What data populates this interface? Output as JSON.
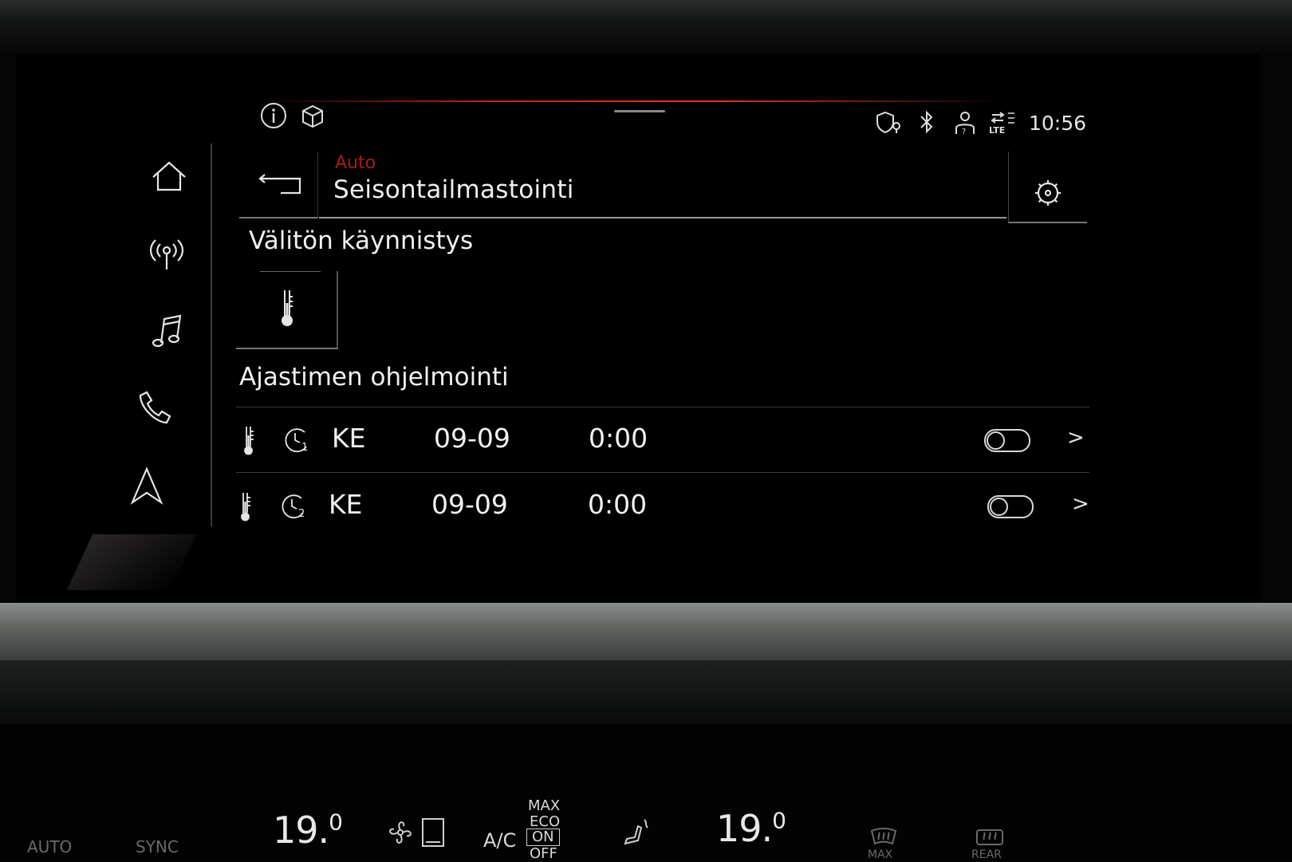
{
  "status_bar": {
    "time": "10:56",
    "lte_label": "LTE"
  },
  "sidebar": {
    "items": [
      {
        "name": "home",
        "icon": "home-icon"
      },
      {
        "name": "radio",
        "icon": "radio-antenna-icon"
      },
      {
        "name": "media",
        "icon": "music-note-icon"
      },
      {
        "name": "phone",
        "icon": "phone-icon"
      },
      {
        "name": "navigation",
        "icon": "navigation-arrow-icon"
      }
    ]
  },
  "header": {
    "breadcrumb": "Auto",
    "title": "Seisontailmastointi"
  },
  "immediate_start": {
    "title": "Välitön käynnistys"
  },
  "timer_section": {
    "title": "Ajastimen ohjelmointi",
    "timers": [
      {
        "timer_number": "1",
        "day": "KE",
        "date": "09-09",
        "time": "0:00",
        "enabled": false
      },
      {
        "timer_number": "2",
        "day": "KE",
        "date": "09-09",
        "time": "0:00",
        "enabled": false
      }
    ]
  },
  "climate_bar": {
    "auto_label": "AUTO",
    "sync_label": "SYNC",
    "left_temp": "19.",
    "left_temp_decimal": "0",
    "ac_label": "A/C",
    "max_label": "MAX",
    "eco_label": "ECO",
    "on_label": "ON",
    "off_label": "OFF",
    "right_temp": "19.",
    "right_temp_decimal": "0",
    "max_defrost_label": "MAX",
    "rear_defrost_label": "REAR"
  },
  "colors": {
    "accent_red": "#a61e1a",
    "text": "#f2f2f2",
    "background": "#000000"
  }
}
